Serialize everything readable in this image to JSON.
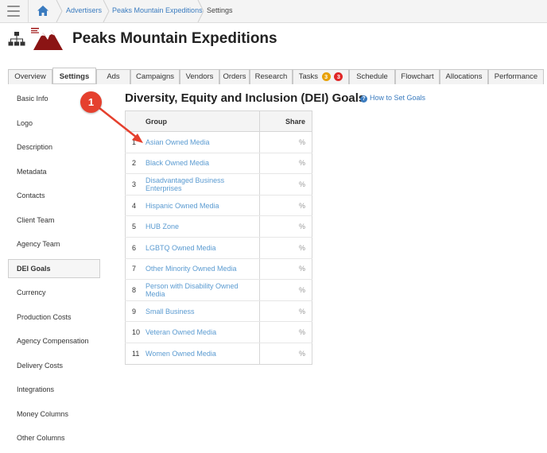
{
  "breadcrumb": {
    "items": [
      "Advertisers",
      "Peaks Mountain Expeditions",
      "Settings"
    ]
  },
  "header": {
    "title": "Peaks Mountain Expeditions"
  },
  "tabs": [
    {
      "label": "Overview"
    },
    {
      "label": "Settings",
      "active": true
    },
    {
      "label": "Ads"
    },
    {
      "label": "Campaigns"
    },
    {
      "label": "Vendors"
    },
    {
      "label": "Orders"
    },
    {
      "label": "Research"
    },
    {
      "label": "Tasks",
      "badges": [
        "3",
        "3"
      ]
    },
    {
      "label": "Schedule"
    },
    {
      "label": "Flowchart"
    },
    {
      "label": "Allocations"
    },
    {
      "label": "Performance"
    }
  ],
  "sidebar": {
    "items": [
      {
        "label": "Basic Info"
      },
      {
        "label": "Logo"
      },
      {
        "label": "Description"
      },
      {
        "label": "Metadata"
      },
      {
        "label": "Contacts"
      },
      {
        "label": "Client Team"
      },
      {
        "label": "Agency Team"
      },
      {
        "label": "DEI Goals",
        "active": true
      },
      {
        "label": "Currency"
      },
      {
        "label": "Production Costs"
      },
      {
        "label": "Agency Compensation"
      },
      {
        "label": "Delivery Costs"
      },
      {
        "label": "Integrations"
      },
      {
        "label": "Money Columns"
      },
      {
        "label": "Other Columns"
      }
    ]
  },
  "section": {
    "title": "Diversity, Equity and Inclusion (DEI) Goals",
    "help_link": "How to Set Goals",
    "help_icon": "?"
  },
  "table": {
    "headers": {
      "group": "Group",
      "share": "Share"
    },
    "rows": [
      {
        "num": "1",
        "group": "Asian Owned Media",
        "share": "%"
      },
      {
        "num": "2",
        "group": "Black Owned Media",
        "share": "%"
      },
      {
        "num": "3",
        "group": "Disadvantaged Business Enterprises",
        "share": "%"
      },
      {
        "num": "4",
        "group": "Hispanic Owned Media",
        "share": "%"
      },
      {
        "num": "5",
        "group": "HUB Zone",
        "share": "%"
      },
      {
        "num": "6",
        "group": "LGBTQ Owned Media",
        "share": "%"
      },
      {
        "num": "7",
        "group": "Other Minority Owned Media",
        "share": "%"
      },
      {
        "num": "8",
        "group": "Person with Disability Owned Media",
        "share": "%"
      },
      {
        "num": "9",
        "group": "Small Business",
        "share": "%"
      },
      {
        "num": "10",
        "group": "Veteran Owned Media",
        "share": "%"
      },
      {
        "num": "11",
        "group": "Women Owned Media",
        "share": "%"
      }
    ]
  },
  "annotation": {
    "number": "1"
  },
  "colors": {
    "link": "#3a7bbf",
    "group_link": "#5b9bd1",
    "annotation": "#e5402e",
    "badge_orange": "#e8a000",
    "badge_red": "#e02626"
  },
  "icons": {
    "menu": "hamburger-menu-icon",
    "home": "home-icon",
    "org": "org-chart-icon",
    "help": "help-icon"
  }
}
